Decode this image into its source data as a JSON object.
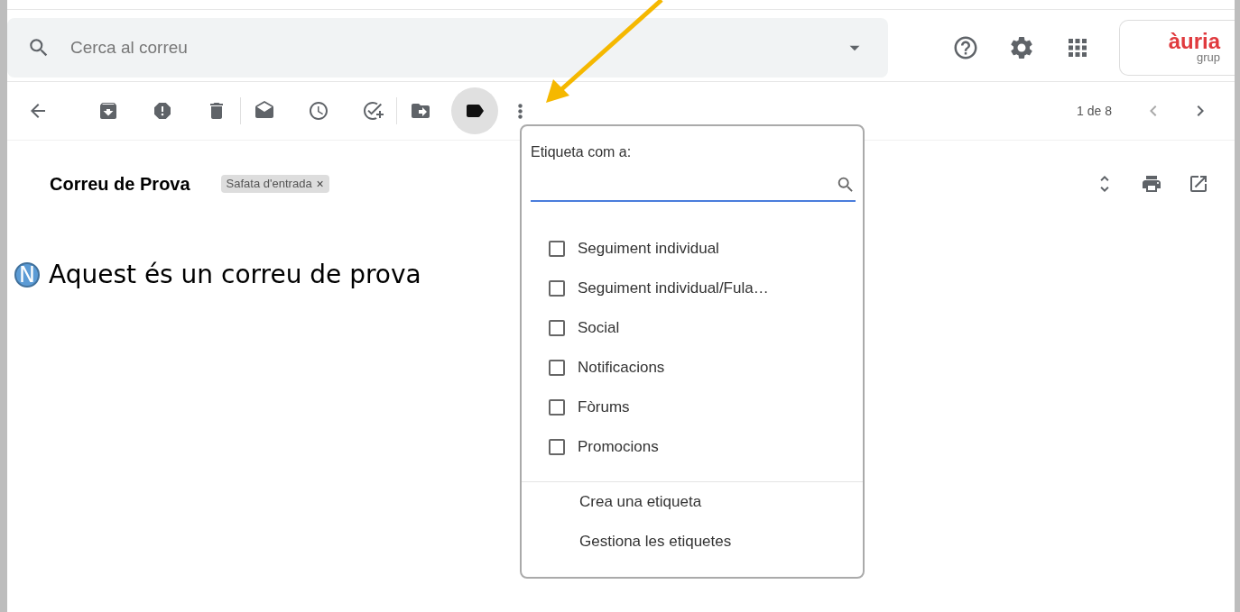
{
  "search": {
    "placeholder": "Cerca al correu"
  },
  "logo": {
    "name": "àuria",
    "sub": "grup"
  },
  "toolbar": {
    "label_menu_open": true,
    "counter": "1 de 8"
  },
  "message": {
    "subject": "Correu de Prova",
    "chip": "Safata d'entrada",
    "chip_close": "×",
    "avatar": "N",
    "body": "Aquest és un correu de prova"
  },
  "label_menu": {
    "title": "Etiqueta com a:",
    "labels": [
      {
        "label": "Seguiment individual",
        "checked": false
      },
      {
        "label": "Seguiment individual/Fula…",
        "checked": false
      },
      {
        "label": "Social",
        "checked": false
      },
      {
        "label": "Notificacions",
        "checked": false
      },
      {
        "label": "Fòrums",
        "checked": false
      },
      {
        "label": "Promocions",
        "checked": false
      }
    ],
    "actions": [
      "Crea una etiqueta",
      "Gestiona les etiquetes"
    ]
  }
}
